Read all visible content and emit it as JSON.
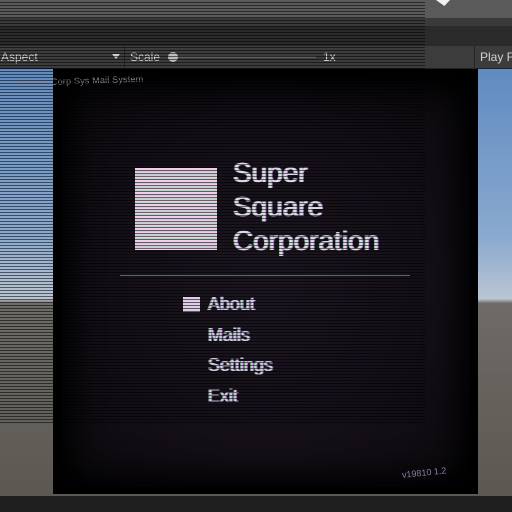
{
  "toolbar": {
    "aspect_label": "Aspect",
    "scale_label": "Scale",
    "scale_value": "1x",
    "scale_slider_value": 0.0,
    "play_label": "Play F"
  },
  "screen": {
    "system_label": "Square Corp Sys Mail System",
    "company_lines": [
      "Super",
      "Square",
      "Corporation"
    ],
    "menu": [
      {
        "label": "About",
        "selected": true
      },
      {
        "label": "Mails",
        "selected": false
      },
      {
        "label": "Settings",
        "selected": false
      },
      {
        "label": "Exit",
        "selected": false
      }
    ],
    "version": "v19810 1.2"
  },
  "colors": {
    "accent_pink": "#e6b8f0",
    "accent_green": "#a4e8b6",
    "screen_bg": "#140f17"
  },
  "icons": {
    "menu_cursor": "block-cursor-icon",
    "logo": "square-logo-icon"
  }
}
